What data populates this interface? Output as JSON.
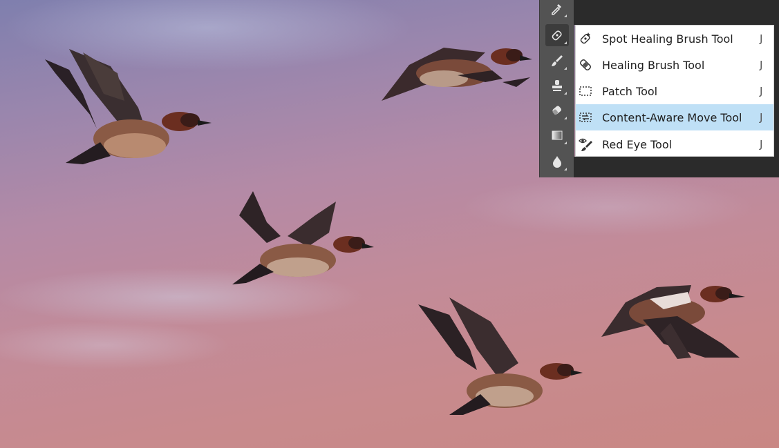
{
  "toolbar": {
    "tools": [
      {
        "name": "eyedropper-icon"
      },
      {
        "name": "spot-healing-brush-icon",
        "active": true
      },
      {
        "name": "brush-icon"
      },
      {
        "name": "clone-stamp-icon"
      },
      {
        "name": "eraser-icon"
      },
      {
        "name": "gradient-icon"
      },
      {
        "name": "blur-drop-icon"
      }
    ]
  },
  "flyout": {
    "items": [
      {
        "label": "Spot Healing Brush Tool",
        "shortcut": "J",
        "icon": "spot-healing-brush-icon"
      },
      {
        "label": "Healing Brush Tool",
        "shortcut": "J",
        "icon": "healing-brush-icon"
      },
      {
        "label": "Patch Tool",
        "shortcut": "J",
        "icon": "patch-icon"
      },
      {
        "label": "Content-Aware Move Tool",
        "shortcut": "J",
        "icon": "content-aware-move-icon",
        "highlighted": true
      },
      {
        "label": "Red Eye Tool",
        "shortcut": "J",
        "icon": "red-eye-icon"
      }
    ]
  },
  "colors": {
    "toolbar_bg": "#535353",
    "panel_bg": "#2b2b2b",
    "highlight": "#bfe0f6"
  }
}
